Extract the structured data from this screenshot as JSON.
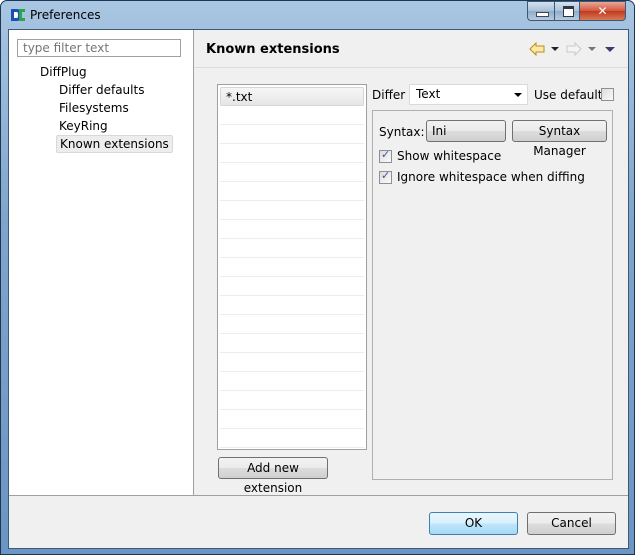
{
  "window": {
    "title": "Preferences",
    "icon": "diffplug-app-icon",
    "controls": {
      "minimize": "minimize-icon",
      "maximize": "maximize-icon",
      "close": "close-icon"
    }
  },
  "sidebar": {
    "filter_placeholder": "type filter text",
    "filter_value": "",
    "tree": [
      {
        "label": "DiffPlug",
        "level": 0,
        "selected": false
      },
      {
        "label": "Differ defaults",
        "level": 1,
        "selected": false
      },
      {
        "label": "Filesystems",
        "level": 1,
        "selected": false
      },
      {
        "label": "KeyRing",
        "level": 1,
        "selected": false
      },
      {
        "label": "Known extensions",
        "level": 1,
        "selected": true
      }
    ]
  },
  "page": {
    "title": "Known extensions",
    "nav": {
      "back": "back-arrow-icon",
      "back_menu": "chevron-down-icon",
      "forward": "forward-arrow-icon",
      "forward_menu": "chevron-down-icon",
      "view_menu": "view-menu-icon"
    },
    "extensions": [
      "*.txt"
    ],
    "add_button": "Add new extension",
    "differ_label": "Differ",
    "differ_value": "Text",
    "use_default_label": "Use default",
    "use_default_checked": false,
    "syntax_label": "Syntax:",
    "syntax_value": "Ini",
    "syntax_manager_button": "Syntax Manager",
    "show_whitespace_label": "Show whitespace",
    "show_whitespace_checked": true,
    "ignore_whitespace_label": "Ignore whitespace when diffing",
    "ignore_whitespace_checked": true
  },
  "footer": {
    "ok_label": "OK",
    "cancel_label": "Cancel"
  },
  "colors": {
    "frame": "#6b95c2",
    "ok_accent": "#3c7fb1",
    "close": "#c03a20"
  }
}
